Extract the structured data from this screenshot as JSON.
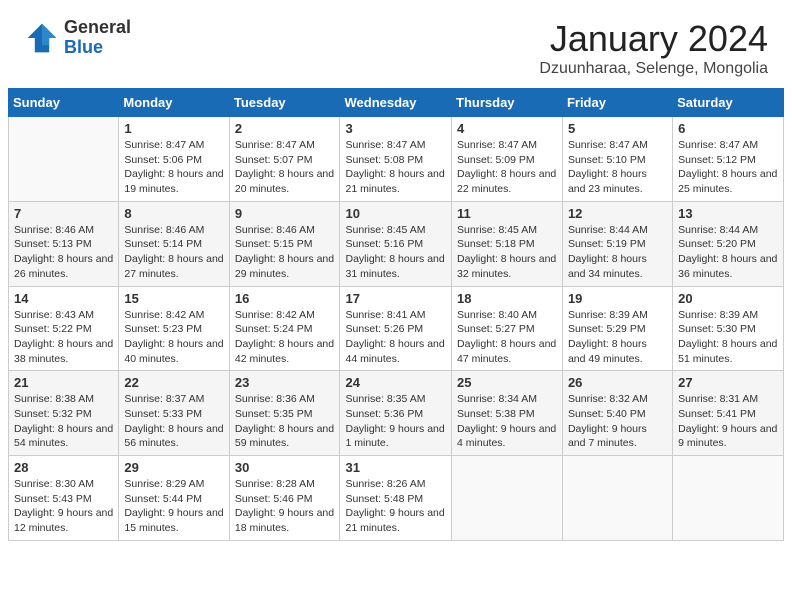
{
  "logo": {
    "general": "General",
    "blue": "Blue"
  },
  "header": {
    "month": "January 2024",
    "location": "Dzuunharaa, Selenge, Mongolia"
  },
  "weekdays": [
    "Sunday",
    "Monday",
    "Tuesday",
    "Wednesday",
    "Thursday",
    "Friday",
    "Saturday"
  ],
  "weeks": [
    [
      {
        "day": "",
        "sunrise": "",
        "sunset": "",
        "daylight": ""
      },
      {
        "day": "1",
        "sunrise": "Sunrise: 8:47 AM",
        "sunset": "Sunset: 5:06 PM",
        "daylight": "Daylight: 8 hours and 19 minutes."
      },
      {
        "day": "2",
        "sunrise": "Sunrise: 8:47 AM",
        "sunset": "Sunset: 5:07 PM",
        "daylight": "Daylight: 8 hours and 20 minutes."
      },
      {
        "day": "3",
        "sunrise": "Sunrise: 8:47 AM",
        "sunset": "Sunset: 5:08 PM",
        "daylight": "Daylight: 8 hours and 21 minutes."
      },
      {
        "day": "4",
        "sunrise": "Sunrise: 8:47 AM",
        "sunset": "Sunset: 5:09 PM",
        "daylight": "Daylight: 8 hours and 22 minutes."
      },
      {
        "day": "5",
        "sunrise": "Sunrise: 8:47 AM",
        "sunset": "Sunset: 5:10 PM",
        "daylight": "Daylight: 8 hours and 23 minutes."
      },
      {
        "day": "6",
        "sunrise": "Sunrise: 8:47 AM",
        "sunset": "Sunset: 5:12 PM",
        "daylight": "Daylight: 8 hours and 25 minutes."
      }
    ],
    [
      {
        "day": "7",
        "sunrise": "Sunrise: 8:46 AM",
        "sunset": "Sunset: 5:13 PM",
        "daylight": "Daylight: 8 hours and 26 minutes."
      },
      {
        "day": "8",
        "sunrise": "Sunrise: 8:46 AM",
        "sunset": "Sunset: 5:14 PM",
        "daylight": "Daylight: 8 hours and 27 minutes."
      },
      {
        "day": "9",
        "sunrise": "Sunrise: 8:46 AM",
        "sunset": "Sunset: 5:15 PM",
        "daylight": "Daylight: 8 hours and 29 minutes."
      },
      {
        "day": "10",
        "sunrise": "Sunrise: 8:45 AM",
        "sunset": "Sunset: 5:16 PM",
        "daylight": "Daylight: 8 hours and 31 minutes."
      },
      {
        "day": "11",
        "sunrise": "Sunrise: 8:45 AM",
        "sunset": "Sunset: 5:18 PM",
        "daylight": "Daylight: 8 hours and 32 minutes."
      },
      {
        "day": "12",
        "sunrise": "Sunrise: 8:44 AM",
        "sunset": "Sunset: 5:19 PM",
        "daylight": "Daylight: 8 hours and 34 minutes."
      },
      {
        "day": "13",
        "sunrise": "Sunrise: 8:44 AM",
        "sunset": "Sunset: 5:20 PM",
        "daylight": "Daylight: 8 hours and 36 minutes."
      }
    ],
    [
      {
        "day": "14",
        "sunrise": "Sunrise: 8:43 AM",
        "sunset": "Sunset: 5:22 PM",
        "daylight": "Daylight: 8 hours and 38 minutes."
      },
      {
        "day": "15",
        "sunrise": "Sunrise: 8:42 AM",
        "sunset": "Sunset: 5:23 PM",
        "daylight": "Daylight: 8 hours and 40 minutes."
      },
      {
        "day": "16",
        "sunrise": "Sunrise: 8:42 AM",
        "sunset": "Sunset: 5:24 PM",
        "daylight": "Daylight: 8 hours and 42 minutes."
      },
      {
        "day": "17",
        "sunrise": "Sunrise: 8:41 AM",
        "sunset": "Sunset: 5:26 PM",
        "daylight": "Daylight: 8 hours and 44 minutes."
      },
      {
        "day": "18",
        "sunrise": "Sunrise: 8:40 AM",
        "sunset": "Sunset: 5:27 PM",
        "daylight": "Daylight: 8 hours and 47 minutes."
      },
      {
        "day": "19",
        "sunrise": "Sunrise: 8:39 AM",
        "sunset": "Sunset: 5:29 PM",
        "daylight": "Daylight: 8 hours and 49 minutes."
      },
      {
        "day": "20",
        "sunrise": "Sunrise: 8:39 AM",
        "sunset": "Sunset: 5:30 PM",
        "daylight": "Daylight: 8 hours and 51 minutes."
      }
    ],
    [
      {
        "day": "21",
        "sunrise": "Sunrise: 8:38 AM",
        "sunset": "Sunset: 5:32 PM",
        "daylight": "Daylight: 8 hours and 54 minutes."
      },
      {
        "day": "22",
        "sunrise": "Sunrise: 8:37 AM",
        "sunset": "Sunset: 5:33 PM",
        "daylight": "Daylight: 8 hours and 56 minutes."
      },
      {
        "day": "23",
        "sunrise": "Sunrise: 8:36 AM",
        "sunset": "Sunset: 5:35 PM",
        "daylight": "Daylight: 8 hours and 59 minutes."
      },
      {
        "day": "24",
        "sunrise": "Sunrise: 8:35 AM",
        "sunset": "Sunset: 5:36 PM",
        "daylight": "Daylight: 9 hours and 1 minute."
      },
      {
        "day": "25",
        "sunrise": "Sunrise: 8:34 AM",
        "sunset": "Sunset: 5:38 PM",
        "daylight": "Daylight: 9 hours and 4 minutes."
      },
      {
        "day": "26",
        "sunrise": "Sunrise: 8:32 AM",
        "sunset": "Sunset: 5:40 PM",
        "daylight": "Daylight: 9 hours and 7 minutes."
      },
      {
        "day": "27",
        "sunrise": "Sunrise: 8:31 AM",
        "sunset": "Sunset: 5:41 PM",
        "daylight": "Daylight: 9 hours and 9 minutes."
      }
    ],
    [
      {
        "day": "28",
        "sunrise": "Sunrise: 8:30 AM",
        "sunset": "Sunset: 5:43 PM",
        "daylight": "Daylight: 9 hours and 12 minutes."
      },
      {
        "day": "29",
        "sunrise": "Sunrise: 8:29 AM",
        "sunset": "Sunset: 5:44 PM",
        "daylight": "Daylight: 9 hours and 15 minutes."
      },
      {
        "day": "30",
        "sunrise": "Sunrise: 8:28 AM",
        "sunset": "Sunset: 5:46 PM",
        "daylight": "Daylight: 9 hours and 18 minutes."
      },
      {
        "day": "31",
        "sunrise": "Sunrise: 8:26 AM",
        "sunset": "Sunset: 5:48 PM",
        "daylight": "Daylight: 9 hours and 21 minutes."
      },
      {
        "day": "",
        "sunrise": "",
        "sunset": "",
        "daylight": ""
      },
      {
        "day": "",
        "sunrise": "",
        "sunset": "",
        "daylight": ""
      },
      {
        "day": "",
        "sunrise": "",
        "sunset": "",
        "daylight": ""
      }
    ]
  ]
}
